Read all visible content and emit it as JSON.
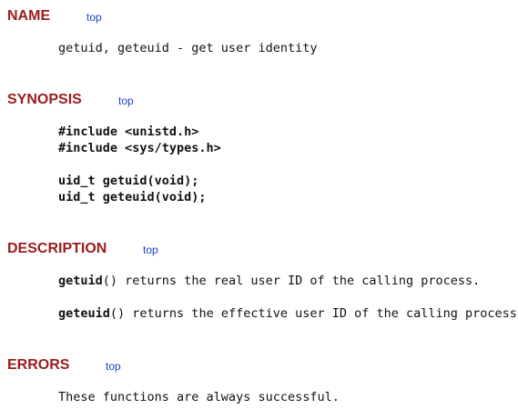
{
  "sections": [
    {
      "heading": "NAME",
      "top_link": "top",
      "text": "getuid, geteuid - get user identity"
    },
    {
      "heading": "SYNOPSIS",
      "top_link": "top",
      "lines": [
        "#include <unistd.h>",
        "#include <sys/types.h>",
        "uid_t getuid(void);",
        "uid_t geteuid(void);"
      ]
    },
    {
      "heading": "DESCRIPTION",
      "top_link": "top",
      "paragraphs": [
        {
          "func": "getuid",
          "rest": "() returns the real user ID of the calling process."
        },
        {
          "func": "geteuid",
          "rest": "() returns the effective user ID of the calling process."
        }
      ]
    },
    {
      "heading": "ERRORS",
      "top_link": "top",
      "text": "These functions are always successful."
    }
  ]
}
